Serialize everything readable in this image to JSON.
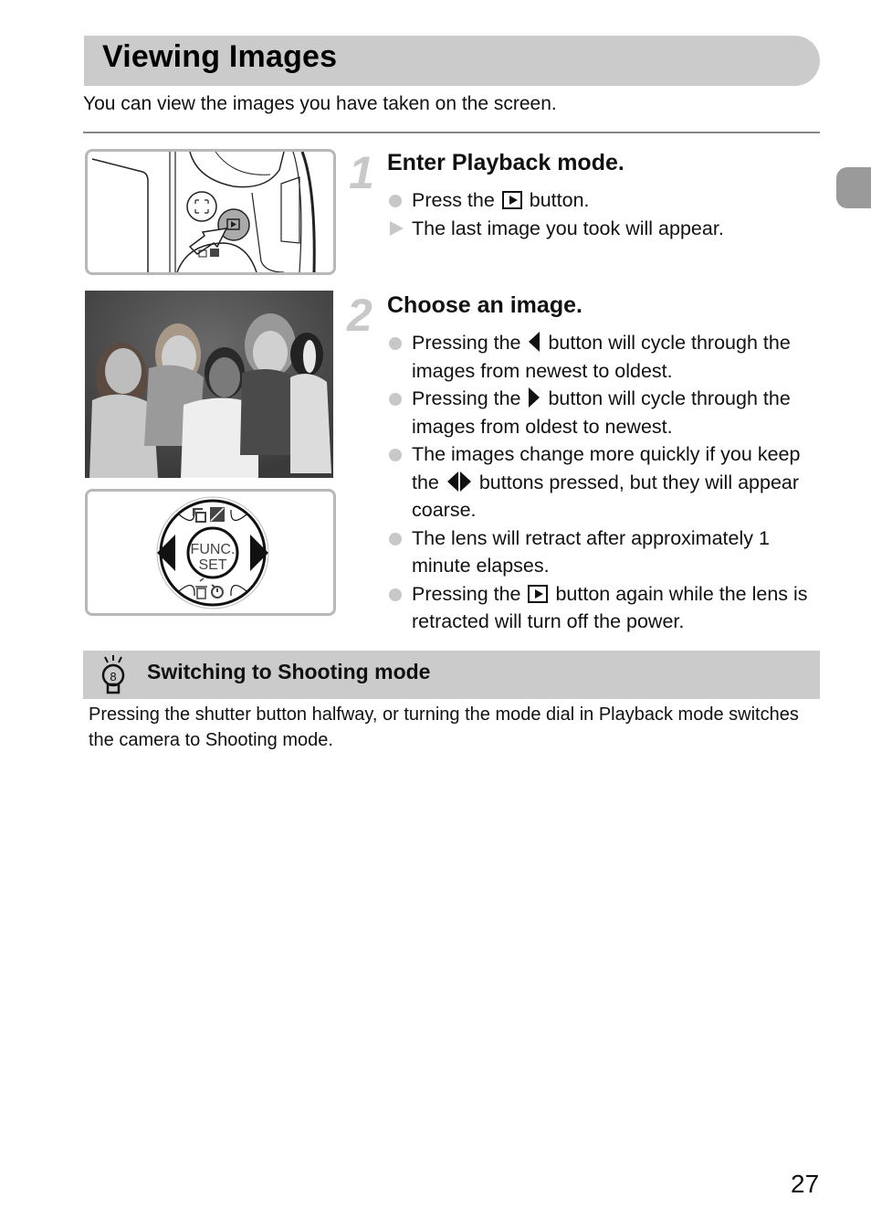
{
  "header": {
    "title": "Viewing Images",
    "intro": "You can view the images you have taken on the screen."
  },
  "steps": [
    {
      "number": "1",
      "title": "Enter Playback mode.",
      "items": [
        {
          "type": "bullet",
          "before": "Press the ",
          "icon": "playback-button-icon",
          "after": " button."
        },
        {
          "type": "result",
          "text": "The last image you took will appear."
        }
      ]
    },
    {
      "number": "2",
      "title": "Choose an image.",
      "items": [
        {
          "type": "bullet",
          "before": "Pressing the ",
          "icon": "left-arrow-icon",
          "after": " button will cycle through the images from newest to oldest."
        },
        {
          "type": "bullet",
          "before": "Pressing the ",
          "icon": "right-arrow-icon",
          "after": " button will cycle through the images from oldest to newest."
        },
        {
          "type": "bullet",
          "before": "The images change more quickly if you keep the ",
          "icon": "left-right-arrows-icon",
          "after": " buttons pressed, but they will appear coarse."
        },
        {
          "type": "bullet",
          "text": "The lens will retract after approximately 1 minute elapses."
        },
        {
          "type": "bullet",
          "before": "Pressing the ",
          "icon": "playback-button-icon",
          "after": " button again while the lens is retracted will turn off the power."
        }
      ]
    }
  ],
  "illustrations": {
    "dial_center_line1": "FUNC.",
    "dial_center_line2": "SET"
  },
  "tip": {
    "icon": "lightbulb-icon",
    "title": "Switching to Shooting mode",
    "text": "Pressing the shutter button halfway, or turning the mode dial in Playback mode switches the camera to Shooting mode."
  },
  "page_number": "27"
}
